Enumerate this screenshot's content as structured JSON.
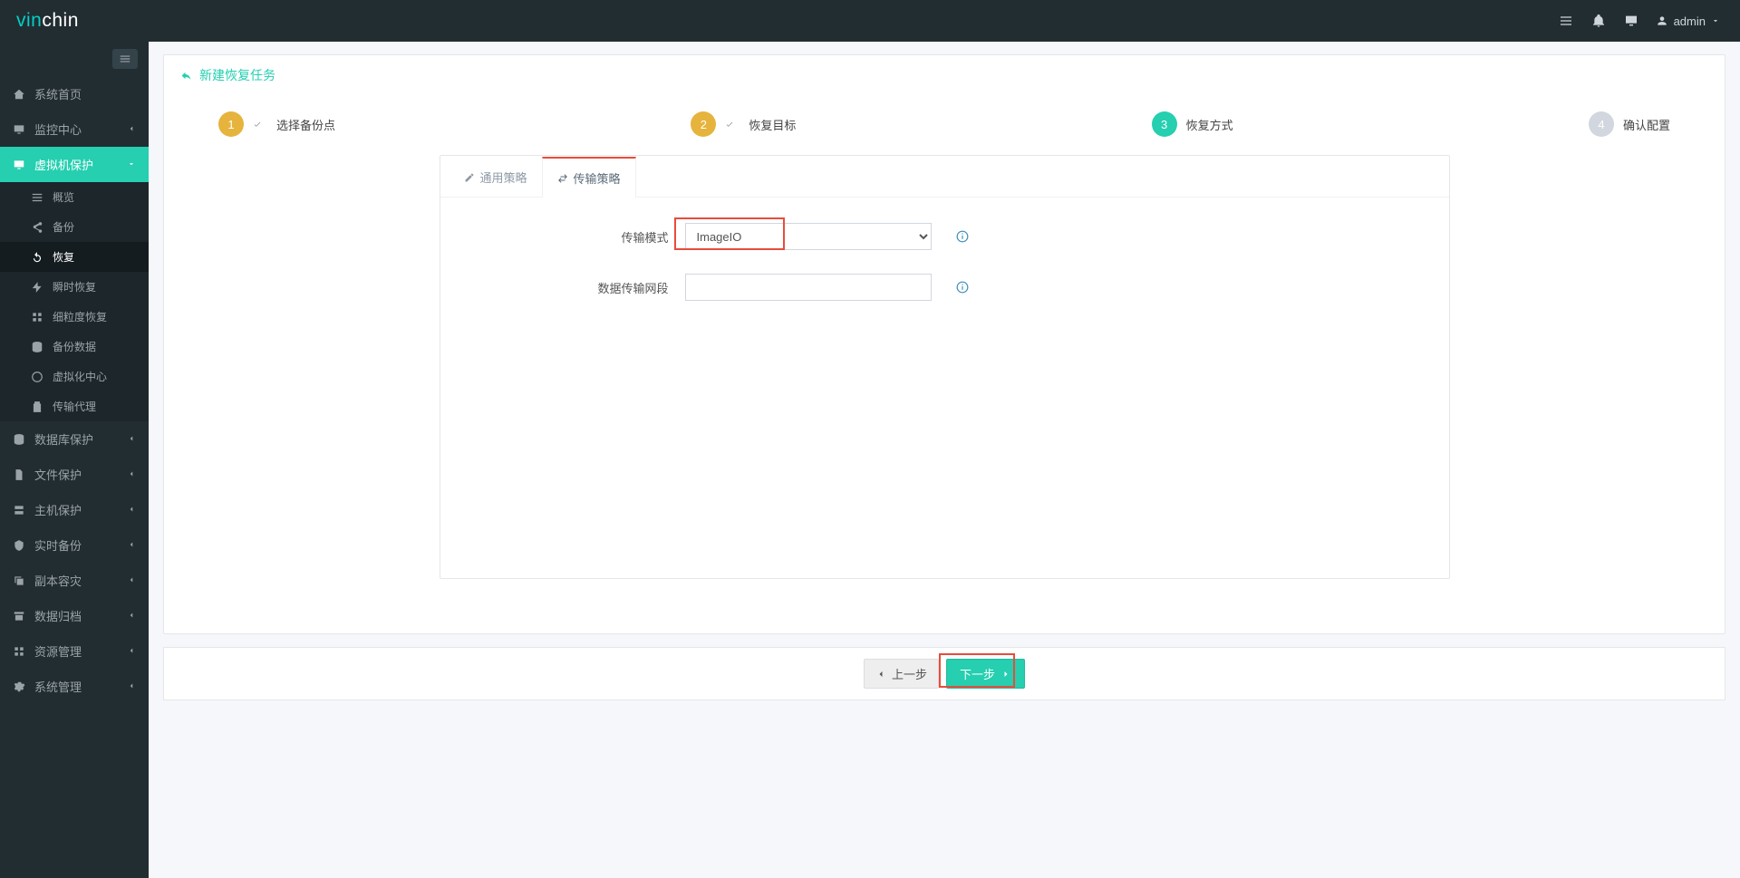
{
  "logo": {
    "thin": "vin",
    "rest": "chin"
  },
  "user": {
    "name": "admin"
  },
  "sidebar": {
    "items": [
      {
        "label": "系统首页"
      },
      {
        "label": "监控中心"
      },
      {
        "label": "虚拟机保护"
      },
      {
        "label": "数据库保护"
      },
      {
        "label": "文件保护"
      },
      {
        "label": "主机保护"
      },
      {
        "label": "实时备份"
      },
      {
        "label": "副本容灾"
      },
      {
        "label": "数据归档"
      },
      {
        "label": "资源管理"
      },
      {
        "label": "系统管理"
      }
    ],
    "sub_vm": [
      {
        "label": "概览"
      },
      {
        "label": "备份"
      },
      {
        "label": "恢复"
      },
      {
        "label": "瞬时恢复"
      },
      {
        "label": "细粒度恢复"
      },
      {
        "label": "备份数据"
      },
      {
        "label": "虚拟化中心"
      },
      {
        "label": "传输代理"
      }
    ]
  },
  "page_title": "新建恢复任务",
  "steps": {
    "s1": "选择备份点",
    "s2": "恢复目标",
    "s3": "恢复方式",
    "s4": "确认配置"
  },
  "tabs": {
    "general": "通用策略",
    "transfer": "传输策略"
  },
  "form": {
    "mode_label": "传输模式",
    "mode_value": "ImageIO",
    "netseg_label": "数据传输网段",
    "netseg_value": ""
  },
  "buttons": {
    "prev": "上一步",
    "next": "下一步"
  }
}
